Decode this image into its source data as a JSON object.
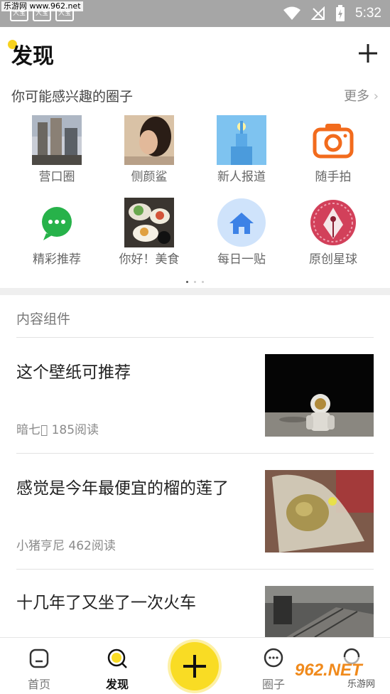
{
  "watermark_top": "乐游网 www.962.net",
  "status_bar": {
    "time": "5:32",
    "icon_a": "大宝",
    "icon_b": "大宝"
  },
  "header": {
    "title": "发现"
  },
  "circles": {
    "heading": "你可能感兴趣的圈子",
    "more": "更多",
    "items": [
      {
        "label": "营口圈",
        "icon": "city-photo"
      },
      {
        "label": "侧颜鲨",
        "icon": "portrait-photo"
      },
      {
        "label": "新人报道",
        "icon": "tower-illustration"
      },
      {
        "label": "随手拍",
        "icon": "camera-icon"
      },
      {
        "label": "精彩推荐",
        "icon": "chat-bubble-icon"
      },
      {
        "label": "你好！美食",
        "icon": "food-photo"
      },
      {
        "label": "每日一贴",
        "icon": "home-icon"
      },
      {
        "label": "原创星球",
        "icon": "pen-nib-icon"
      }
    ],
    "page_count": 3,
    "active_page": 1
  },
  "content": {
    "heading": "内容组件",
    "articles": [
      {
        "title": "这个壁纸可推荐",
        "meta": "暗七\u0000 185阅读",
        "image": "astronaut-on-moon"
      },
      {
        "title": "感觉是今年最便宜的榴的莲了",
        "meta": "小猪亨尼 462阅读",
        "image": "durian-in-bag"
      },
      {
        "title": "十几年了又坐了一次火车",
        "meta": "",
        "image": "train-station"
      }
    ]
  },
  "tabbar": {
    "tabs": [
      {
        "label": "首页",
        "icon": "home-outline-icon",
        "active": false
      },
      {
        "label": "发现",
        "icon": "discover-icon",
        "active": true
      },
      {
        "label": "",
        "icon": "plus-icon",
        "active": false
      },
      {
        "label": "圈子",
        "icon": "chat-outline-icon",
        "active": false
      },
      {
        "label": "",
        "icon": "profile-icon",
        "active": false
      }
    ]
  },
  "watermark_bottom": {
    "brand": "962.NET",
    "subtitle": "乐游网"
  },
  "colors": {
    "accent_yellow": "#f9dc24",
    "status_bar": "#a6a6a6",
    "camera_orange": "#f26b1d",
    "chat_green": "#27b24a",
    "home_blue": "#3d82e6",
    "pen_red": "#c0392b"
  }
}
